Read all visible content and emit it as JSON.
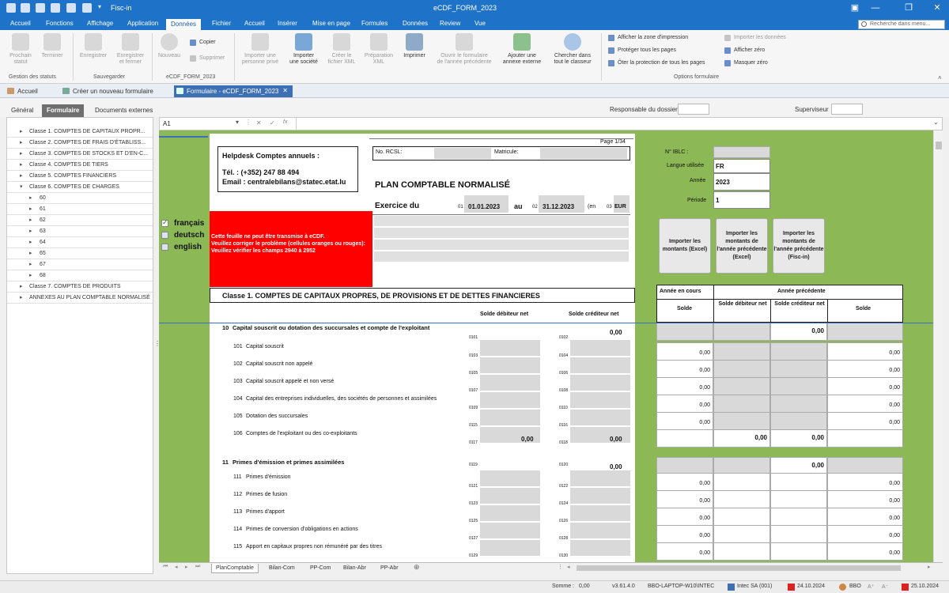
{
  "window": {
    "app_title": "Fisc-in",
    "title": "eCDF_FORM_2023"
  },
  "menu": [
    "Accueil",
    "Fonctions",
    "Affichage",
    "Application",
    "Données",
    "Fichier",
    "Accueil",
    "Insérer",
    "Mise en page",
    "Formules",
    "Données",
    "Review",
    "Vue"
  ],
  "search_placeholder": "Recherche dans menu...",
  "ribbon": {
    "buttons": [
      {
        "label": "Prochain\nstatut",
        "icon": "next-status-icon",
        "enabled": false
      },
      {
        "label": "Terminer",
        "icon": "finish-icon",
        "enabled": false
      },
      {
        "label": "Enregistrer",
        "icon": "save-icon",
        "enabled": false
      },
      {
        "label": "Enregistrer\net fermer",
        "icon": "save-close-icon",
        "enabled": false
      },
      {
        "label": "Nouveau",
        "icon": "new-icon",
        "enabled": false
      },
      {
        "label": "Importer une\npersonne privé",
        "icon": "import-person-icon",
        "enabled": false
      },
      {
        "label": "Importer\nune société",
        "icon": "import-company-icon",
        "enabled": true
      },
      {
        "label": "Créer le\nfichier XML",
        "icon": "xml-icon",
        "enabled": false
      },
      {
        "label": "Préparation\nXML",
        "icon": "xml-prep-icon",
        "enabled": false
      },
      {
        "label": "Imprimer",
        "icon": "print-icon",
        "enabled": true
      },
      {
        "label": "Ouvrir le formulaire\nde l'année précédente",
        "icon": "open-previous-icon",
        "enabled": false
      },
      {
        "label": "Ajouter une\nannexe externe",
        "icon": "excel-icon",
        "enabled": true
      },
      {
        "label": "Chercher dans\ntout le classeur",
        "icon": "search-icon",
        "enabled": true
      }
    ],
    "copy_label": "Copier",
    "delete_label": "Supprimer",
    "options_left": [
      "Afficher la zone d'impression",
      "Protéger tous les pages",
      "Ôter la protection de tous les pages"
    ],
    "options_right": [
      "Importer les données",
      "Afficher zéro",
      "Masquer zéro"
    ],
    "groups": [
      "Gestion des statuts",
      "Sauvegarder",
      "eCDF_FORM_2023",
      "Options formulaire"
    ]
  },
  "doc_tabs": [
    "Accueil",
    "Créer un nouveau formulaire",
    "Formulaire - eCDF_FORM_2023"
  ],
  "form_tabs": [
    "Général",
    "Formulaire",
    "Documents externes"
  ],
  "header_fields": {
    "responsable_label": "Responsable du dossier",
    "superviseur_label": "Superviseur"
  },
  "tree": [
    {
      "label": "Classe 1. COMPTES DE CAPITAUX PROPR...",
      "level": 0
    },
    {
      "label": "Classe 2. COMPTES DE FRAIS D'ÉTABLISS...",
      "level": 0
    },
    {
      "label": "Classe 3. COMPTES DE STOCKS ET D'EN-C...",
      "level": 0
    },
    {
      "label": "Classe 4. COMPTES DE TIERS",
      "level": 0
    },
    {
      "label": "Classe 5. COMPTES FINANCIERS",
      "level": 0
    },
    {
      "label": "Classe 6. COMPTES DE CHARGES",
      "level": 0,
      "expanded": true
    },
    {
      "label": "60",
      "level": 1
    },
    {
      "label": "61",
      "level": 1
    },
    {
      "label": "62",
      "level": 1
    },
    {
      "label": "63",
      "level": 1
    },
    {
      "label": "64",
      "level": 1
    },
    {
      "label": "65",
      "level": 1
    },
    {
      "label": "67",
      "level": 1
    },
    {
      "label": "68",
      "level": 1
    },
    {
      "label": "Classe 7. COMPTES DE PRODUITS",
      "level": 0
    },
    {
      "label": "ANNEXES AU PLAN COMPTABLE NORMALISÉ",
      "level": 0
    }
  ],
  "formula_bar": {
    "cell_ref": "A1",
    "value": ""
  },
  "form": {
    "page": "Page 1/34",
    "helpdesk_title": "Helpdesk Comptes annuels :",
    "tel": "Tél.    : (+352) 247 88 494",
    "email": "Email : centralebilans@statec.etat.lu",
    "rcsl_label": "No. RCSL:",
    "matricule_label": "Matricule:",
    "title": "PLAN COMPTABLE NORMALISÉ",
    "exercice_label": "Exercice du",
    "code_01": "01",
    "date_from": "01.01.2023",
    "au_label": "au",
    "code_02": "02",
    "date_to": "31.12.2023",
    "en_label": "(en",
    "code_03": "03",
    "currency": "EUR",
    "error_text": "Cette feuille ne peut être transmise à eCDF.\nVeuillez corriger le problème (cellules oranges ou rouges):\nVeuillez vérifier les champs 2940 à 2952",
    "languages": [
      {
        "label": "français",
        "checked": true
      },
      {
        "label": "deutsch",
        "checked": false
      },
      {
        "label": "english",
        "checked": false
      }
    ],
    "section_title": "Classe 1. COMPTES DE CAPITAUX PROPRES, DE PROVISIONS ET DE DETTES FINANCIERES",
    "col_debit": "Solde débiteur net",
    "col_credit": "Solde créditeur net",
    "info": {
      "iblc_label": "N° IBLC :",
      "iblc_value": "",
      "lang_label": "Langue utilisée",
      "lang_value": "FR",
      "annee_label": "Année",
      "annee_value": "2023",
      "periode_label": "Période",
      "periode_value": "1"
    },
    "import_buttons": [
      "Importer les montants (Excel)",
      "Importer les montants de l'année précédente (Excel)",
      "Importer les montants de l'année précédente (Fisc-in)"
    ],
    "right_headers": {
      "current": "Année en cours",
      "previous": "Année précédente",
      "solde": "Solde",
      "debit": "Solde débiteur net",
      "credit": "Solde créditeur net",
      "solde2": "Solde"
    },
    "rows": [
      {
        "num": "10",
        "label": "Capital souscrit ou dotation des succursales et compte de l'exploitant",
        "bold": true,
        "c1": "",
        "c2": "",
        "v2": "0,00",
        "r_solde": "",
        "r_deb": "",
        "r_cred": "0,00",
        "r_solde2": ""
      },
      {
        "num": "101",
        "label": "Capital souscrit",
        "c1": "0101",
        "c2": "0102",
        "v2": "",
        "r_solde": "0,00",
        "r_deb": "",
        "r_cred": "",
        "r_solde2": "0,00",
        "lc1": "0103",
        "lc2": "0104"
      },
      {
        "num": "102",
        "label": "Capital souscrit non appelé",
        "c1": "0103",
        "c2": "0104",
        "v2": "",
        "r_solde": "0,00",
        "r_deb": "",
        "r_cred": "",
        "r_solde2": "0,00",
        "lc1": "0105",
        "lc2": "0106"
      },
      {
        "num": "103",
        "label": "Capital souscrit appelé et non versé",
        "c1": "0105",
        "c2": "0106",
        "v2": "",
        "r_solde": "0,00",
        "r_deb": "",
        "r_cred": "",
        "r_solde2": "0,00",
        "lc1": "0107",
        "lc2": "0108"
      },
      {
        "num": "104",
        "label": "Capital des entreprises individuelles, des sociétés de personnes et assimilées",
        "c1": "0107",
        "c2": "0108",
        "v2": "",
        "r_solde": "0,00",
        "r_deb": "",
        "r_cred": "",
        "r_solde2": "0,00",
        "lc1": "0109",
        "lc2": "0110"
      },
      {
        "num": "105",
        "label": "Dotation des succursales",
        "c1": "0109",
        "c2": "0110",
        "v2": "",
        "r_solde": "0,00",
        "r_deb": "",
        "r_cred": "",
        "r_solde2": "0,00",
        "lc1": "0115",
        "lc2": "0116"
      },
      {
        "num": "106",
        "label": "Comptes de l'exploitant ou des co-exploitants",
        "c1": "0115",
        "c2": "0116",
        "v1": "0,00",
        "v2": "0,00",
        "r_solde": "",
        "r_deb": "0,00",
        "r_cred": "0,00",
        "r_solde2": "",
        "lc1": "0117",
        "lc2": "0118"
      },
      {
        "num": "11",
        "label": "Primes d'émission et primes assimilées",
        "bold": true,
        "c1": "0119",
        "c2": "0120",
        "v2": "0,00",
        "r_solde": "",
        "r_deb": "",
        "r_cred": "0,00",
        "r_solde2": ""
      },
      {
        "num": "111",
        "label": "Primes d'émission",
        "r_solde": "0,00",
        "r_solde2": "0,00",
        "lc1": "0121",
        "lc2": "0122"
      },
      {
        "num": "112",
        "label": "Primes de fusion",
        "r_solde": "0,00",
        "r_solde2": "0,00",
        "lc1": "0123",
        "lc2": "0124"
      },
      {
        "num": "113",
        "label": "Primes d'apport",
        "r_solde": "0,00",
        "r_solde2": "0,00",
        "lc1": "0125",
        "lc2": "0126"
      },
      {
        "num": "114",
        "label": "Primes de conversion d'obligations en actions",
        "r_solde": "0,00",
        "r_solde2": "0,00",
        "lc1": "0127",
        "lc2": "0128"
      },
      {
        "num": "115",
        "label": "Apport en capitaux propres non rémunéré par des titres",
        "r_solde": "0,00",
        "r_solde2": "0,00",
        "lc1": "0129",
        "lc2": "0130"
      }
    ]
  },
  "sheet_tabs": [
    "PlanComptable",
    "Bilan-Com",
    "PP-Com",
    "Bilan-Abr",
    "PP-Abr"
  ],
  "status": {
    "somme": "Somme :",
    "somme_value": "0,00",
    "version": "v3.61.4.0",
    "machine": "BBO-LAPTOP-W10\\INTEC",
    "company": "Intec SA (001)",
    "date1": "24.10.2024",
    "user": "BBO",
    "date2": "25.10.2024"
  }
}
